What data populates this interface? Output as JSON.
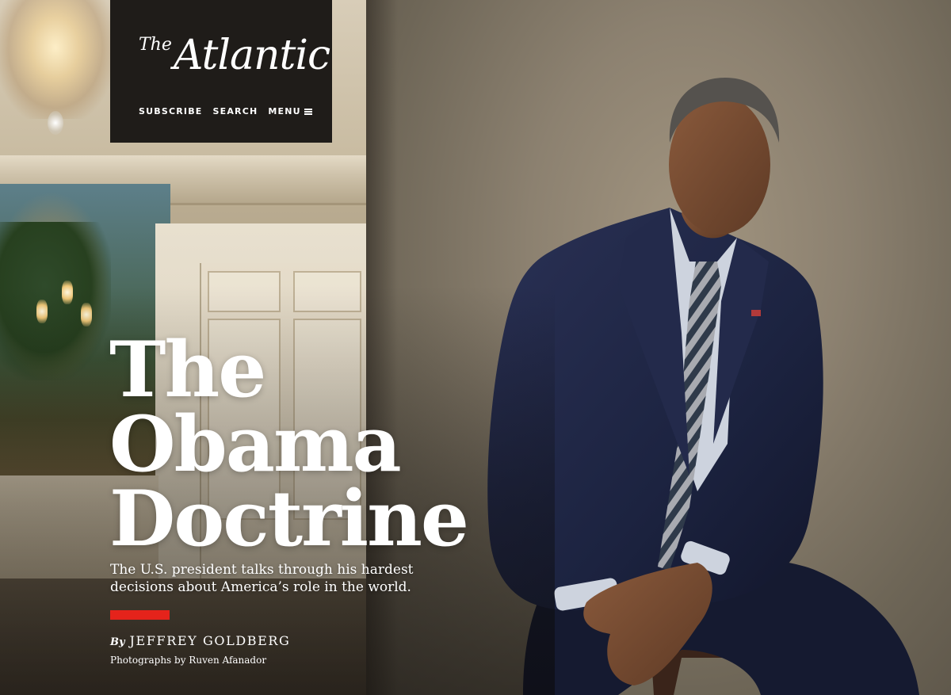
{
  "masthead": {
    "logo_prefix": "The",
    "logo_name": "Atlantic",
    "nav": {
      "subscribe": "SUBSCRIBE",
      "search": "SEARCH",
      "menu": "MENU"
    }
  },
  "article": {
    "headline": [
      "The",
      "Obama",
      "Doctrine"
    ],
    "dek": "The U.S. president talks through his hardest decisions about America’s role in the world.",
    "byline_prefix": "By",
    "author": "JEFFREY GOLDBERG",
    "photo_credit": "Photographs by Ruven Afanador"
  },
  "colors": {
    "accent_rule": "#e5231b",
    "masthead_bg": "#1f1c19",
    "suit": "#1c2340"
  }
}
